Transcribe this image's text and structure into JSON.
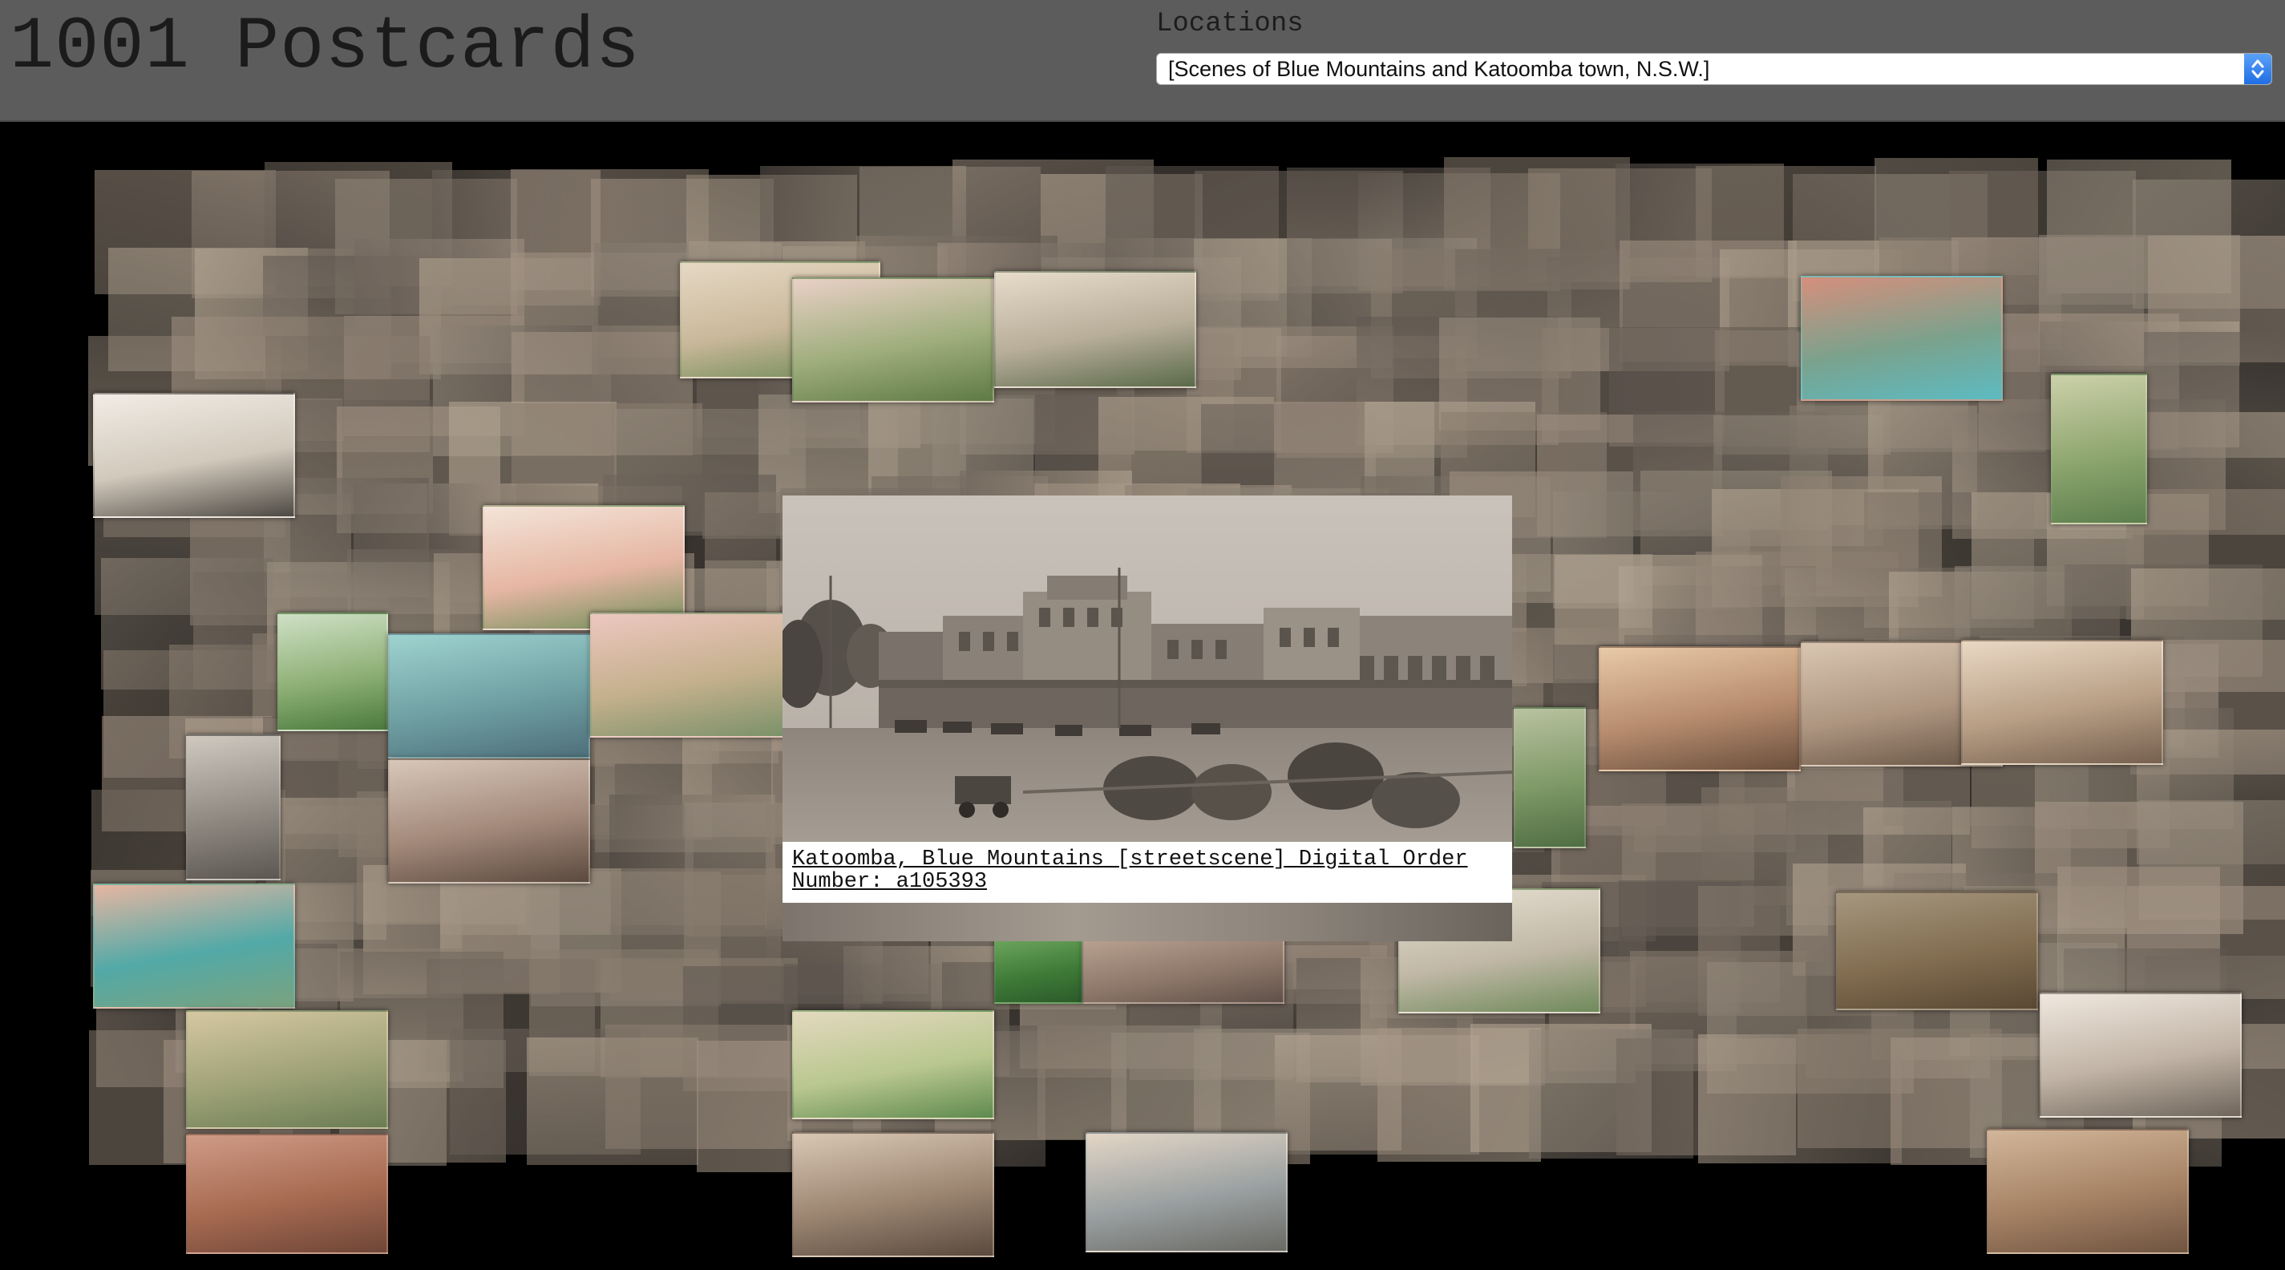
{
  "app": {
    "title": "1001 Postcards"
  },
  "locations": {
    "label": "Locations",
    "selected": "[Scenes of Blue Mountains and Katoomba town, N.S.W.]"
  },
  "selected_postcard": {
    "caption": "Katoomba, Blue Mountains [streetscene] Digital Order Number: a105393"
  },
  "colors": {
    "header_bg": "#5c5c5c",
    "page_bg": "#000000",
    "select_accent": "#2b7bea",
    "sepia_tones": [
      "#8a7d6f",
      "#a39384",
      "#6f655b",
      "#b7a895",
      "#5e564f",
      "#948a7c"
    ]
  }
}
